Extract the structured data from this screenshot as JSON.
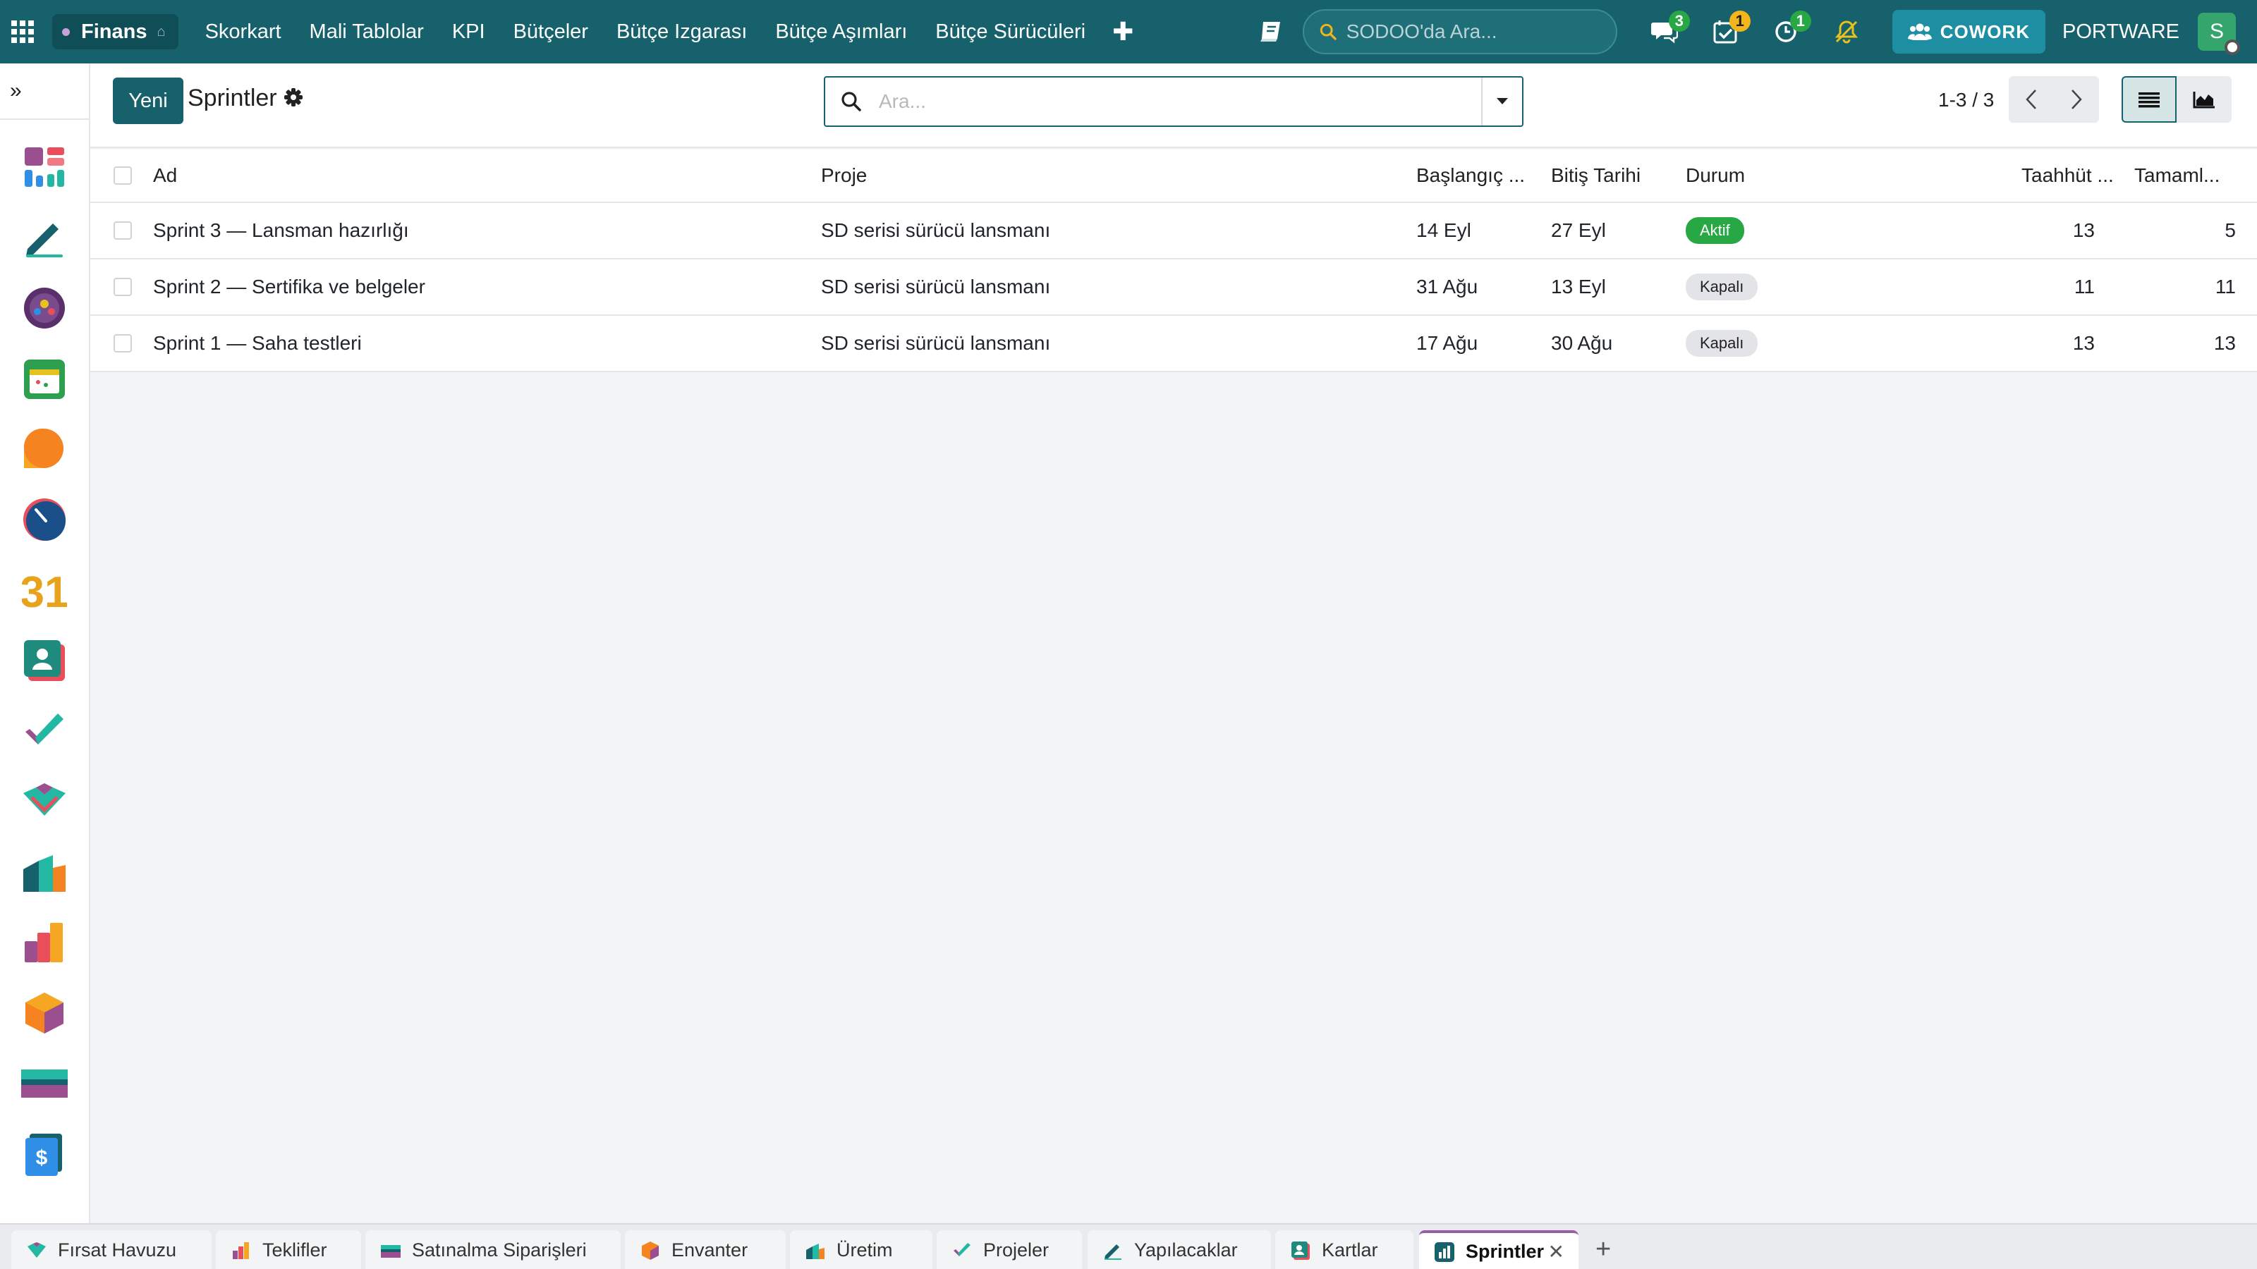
{
  "navbar": {
    "brand": "Finans",
    "menu": [
      "Skorkart",
      "Mali Tablolar",
      "KPI",
      "Bütçeler",
      "Bütçe Izgarası",
      "Bütçe Aşımları",
      "Bütçe Sürücüleri"
    ],
    "search_placeholder": "SODOO'da Ara...",
    "badges": {
      "messages": "3",
      "activities": "1",
      "timers": "1"
    },
    "cowork_label": "COWORK",
    "company": "PORTWARE",
    "avatar_initial": "S",
    "colors": {
      "bar": "#16616b",
      "badge_green": "#28a745",
      "badge_yellow": "#f2b51c"
    }
  },
  "sidebar": {
    "toggle_glyph": "»",
    "apps": [
      "dashboard-app-icon",
      "todo-app-icon",
      "discuss-app-icon",
      "calendar-app-icon",
      "crm-app-icon",
      "dashboard-gauge-app-icon",
      "calendar-31-app-icon",
      "contacts-app-icon",
      "project-app-icon",
      "sales-app-icon",
      "manufacturing-app-icon",
      "reports-app-icon",
      "inventory-app-icon",
      "purchase-app-icon",
      "invoicing-app-icon"
    ],
    "calendar_day": "31"
  },
  "control": {
    "new_label": "Yeni",
    "title": "Sprintler",
    "search_placeholder": "Ara...",
    "pager": "1-3 / 3"
  },
  "table": {
    "columns": [
      "Ad",
      "Proje",
      "Başlangıç ...",
      "Bitiş Tarihi",
      "Durum",
      "Taahhüt ...",
      "Tamaml..."
    ],
    "rows": [
      {
        "name": "Sprint 3 — Lansman hazırlığı",
        "project": "SD serisi sürücü lansmanı",
        "start": "14 Eyl",
        "end": "27 Eyl",
        "status": "Aktif",
        "commit": "13",
        "done": "5"
      },
      {
        "name": "Sprint 2 — Sertifika ve belgeler",
        "project": "SD serisi sürücü lansmanı",
        "start": "31 Ağu",
        "end": "13 Eyl",
        "status": "Kapalı",
        "commit": "11",
        "done": "11"
      },
      {
        "name": "Sprint 1 — Saha testleri",
        "project": "SD serisi sürücü lansmanı",
        "start": "17 Ağu",
        "end": "30 Ağu",
        "status": "Kapalı",
        "commit": "13",
        "done": "13"
      }
    ]
  },
  "tabs": [
    {
      "label": "Fırsat Havuzu",
      "icon": "crm-tab-icon"
    },
    {
      "label": "Teklifler",
      "icon": "sales-tab-icon"
    },
    {
      "label": "Satınalma Siparişleri",
      "icon": "purchase-tab-icon"
    },
    {
      "label": "Envanter",
      "icon": "inventory-tab-icon"
    },
    {
      "label": "Üretim",
      "icon": "manufacturing-tab-icon"
    },
    {
      "label": "Projeler",
      "icon": "project-tab-icon"
    },
    {
      "label": "Yapılacaklar",
      "icon": "todo-tab-icon"
    },
    {
      "label": "Kartlar",
      "icon": "contacts-tab-icon"
    },
    {
      "label": "Sprintler",
      "icon": "chart-tab-icon",
      "active": true
    }
  ]
}
